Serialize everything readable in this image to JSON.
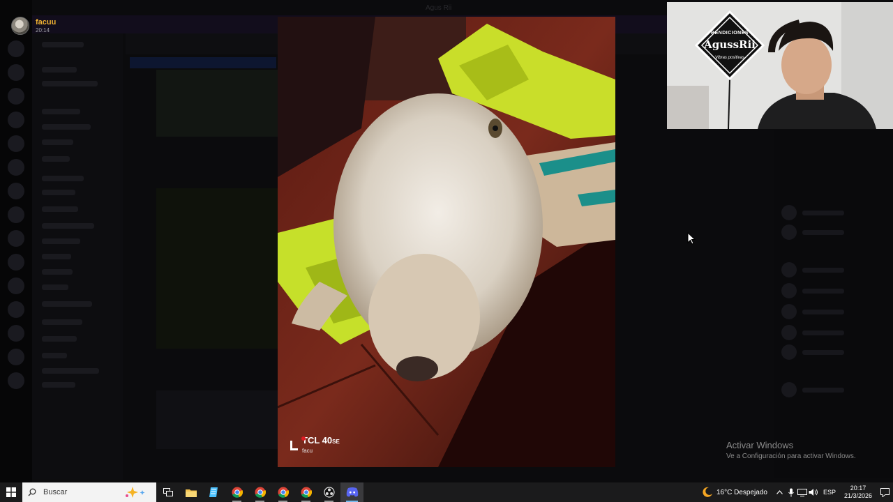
{
  "window": {
    "title": "Agus Rii"
  },
  "viewer": {
    "user_name": "facuu",
    "time": "20:14"
  },
  "photo": {
    "description_icon": "dog-photo",
    "watermark_model": "TCL 40",
    "watermark_model_suffix": "SE",
    "watermark_owner": "facu"
  },
  "webcam": {
    "logo_top": "BENDICIONES",
    "logo_main": "AgussRii",
    "logo_sub": "Vibras positivas"
  },
  "activation": {
    "title": "Activar Windows",
    "subtitle": "Ve a Configuración para activar Windows."
  },
  "taskbar": {
    "search_placeholder": "Buscar",
    "apps": [
      {
        "name": "task-view-icon",
        "active": false
      },
      {
        "name": "file-explorer-icon",
        "active": false
      },
      {
        "name": "notepad-icon",
        "active": false
      },
      {
        "name": "chrome-icon",
        "active": false
      },
      {
        "name": "chrome-icon",
        "active": false
      },
      {
        "name": "chrome-icon",
        "active": false
      },
      {
        "name": "chrome-icon",
        "active": false
      },
      {
        "name": "obs-icon",
        "active": false
      },
      {
        "name": "discord-icon",
        "active": true
      }
    ],
    "weather": "16°C  Despejado",
    "language": "ESP",
    "clock_time": "20:17",
    "clock_date": "21/3/2026",
    "colors": {
      "accent": "#76b9ed",
      "taskbar": "#1b1b1c"
    }
  }
}
